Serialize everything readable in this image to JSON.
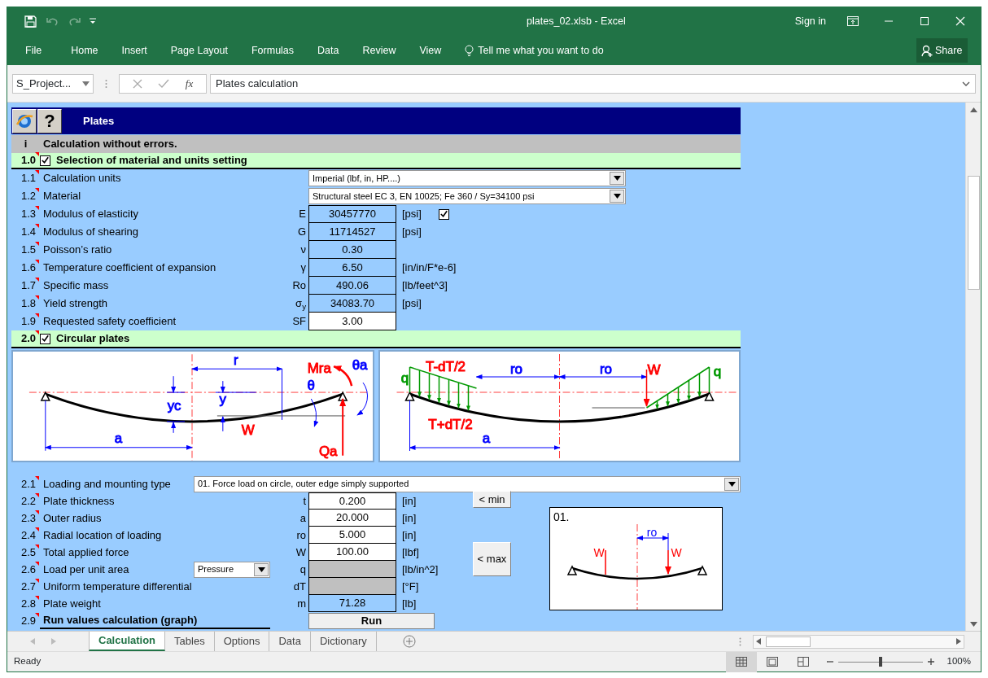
{
  "window": {
    "title": "plates_02.xlsb - Excel",
    "sign_in": "Sign in"
  },
  "quick_access": [
    {
      "kind": "save",
      "disabled": false
    },
    {
      "kind": "undo",
      "disabled": true
    },
    {
      "kind": "redo",
      "disabled": true
    }
  ],
  "ribbon": {
    "tabs": [
      "File",
      "Home",
      "Insert",
      "Page Layout",
      "Formulas",
      "Data",
      "Review",
      "View"
    ],
    "tell_me": "Tell me what you want to do",
    "share": "Share"
  },
  "formula_bar": {
    "name_box": "S_Project...",
    "function_label": "fx",
    "formula": "Plates calculation"
  },
  "sheet": {
    "header": {
      "help": "?",
      "title": "Plates"
    },
    "status_row": {
      "marker": "i",
      "text": "Calculation without errors."
    },
    "sections": [
      {
        "number": "1.0",
        "title": "Selection of material and units setting",
        "checked": true,
        "rows": [
          {
            "kind": "select",
            "number": "1.1",
            "label": "Calculation units",
            "value": "Imperial (lbf, in, HP....)"
          },
          {
            "kind": "select",
            "number": "1.2",
            "label": "Material",
            "value": "Structural steel EC 3, EN 10025; Fe 360 / Sy=34100 psi"
          },
          {
            "kind": "value",
            "number": "1.3",
            "label": "Modulus of elasticity",
            "symbol": "E",
            "value": "30457770",
            "unit": "[psi]",
            "editable": false,
            "disabled": false,
            "checked": true
          },
          {
            "kind": "value",
            "number": "1.4",
            "label": "Modulus of shearing",
            "symbol": "G",
            "value": "11714527",
            "unit": "[psi]",
            "editable": false,
            "disabled": false
          },
          {
            "kind": "value",
            "number": "1.5",
            "label": "Poisson’s ratio",
            "symbol": "ν",
            "value": "0.30",
            "editable": false,
            "disabled": false
          },
          {
            "kind": "value",
            "number": "1.6",
            "label": "Temperature coefficient of expansion",
            "symbol": "γ",
            "value": "6.50",
            "unit": "[in/in/F*e-6]",
            "editable": false,
            "disabled": false
          },
          {
            "kind": "value",
            "number": "1.7",
            "label": "Specific mass",
            "symbol": "Ro",
            "value": "490.06",
            "unit": "[lb/feet^3]",
            "editable": false,
            "disabled": false
          },
          {
            "kind": "value",
            "number": "1.8",
            "label": "Yield strength",
            "symbol": "σ$_{y}$",
            "value": "34083.70",
            "unit": "[psi]",
            "editable": false,
            "disabled": false
          },
          {
            "kind": "value",
            "number": "1.9",
            "label": "Requested safety coefficient",
            "symbol": "SF",
            "value": "3.00",
            "editable": true,
            "disabled": false
          }
        ]
      },
      {
        "number": "2.0",
        "title": "Circular plates",
        "checked": true,
        "diagrams": [
          {
            "labels": [
              {
                "text": "r",
                "color": "#0000ff"
              },
              {
                "text": "Mra",
                "color": "#ff0000"
              },
              {
                "text": "θa",
                "color": "#0000ff"
              },
              {
                "text": "θ",
                "color": "#0000ff"
              },
              {
                "text": "yc",
                "color": "#0000ff"
              },
              {
                "text": "y",
                "color": "#0000ff"
              },
              {
                "text": "W",
                "color": "#ff0000"
              },
              {
                "text": "Qa",
                "color": "#ff0000"
              },
              {
                "text": "a",
                "color": "#0000ff"
              }
            ]
          },
          {
            "labels": [
              {
                "text": "q",
                "color": "#009900"
              },
              {
                "text": "T-dT/2",
                "color": "#ff0000"
              },
              {
                "text": "ro",
                "color": "#0000ff"
              },
              {
                "text": "ro",
                "color": "#0000ff"
              },
              {
                "text": "W",
                "color": "#ff0000"
              },
              {
                "text": "q",
                "color": "#009900"
              },
              {
                "text": "T+dT/2",
                "color": "#ff0000"
              },
              {
                "text": "a",
                "color": "#0000ff"
              }
            ]
          }
        ],
        "rows": [
          {
            "kind": "select",
            "number": "2.1",
            "label": "Loading and mounting type",
            "value": "01. Force load on circle, outer edge simply supported"
          },
          {
            "kind": "value",
            "number": "2.2",
            "label": "Plate thickness",
            "symbol": "t",
            "value": "0.200",
            "unit": "[in]",
            "editable": true,
            "disabled": false
          },
          {
            "kind": "value",
            "number": "2.3",
            "label": "Outer radius",
            "symbol": "a",
            "value": "20.000",
            "unit": "[in]",
            "editable": true,
            "disabled": false
          },
          {
            "kind": "value",
            "number": "2.4",
            "label": "Radial location of loading",
            "symbol": "ro",
            "value": "5.000",
            "unit": "[in]",
            "editable": true,
            "disabled": false
          },
          {
            "kind": "value",
            "number": "2.5",
            "label": "Total applied force",
            "symbol": "W",
            "value": "100.00",
            "unit": "[lbf]",
            "editable": true,
            "disabled": false
          },
          {
            "kind": "value",
            "number": "2.6",
            "label": "Load per unit area",
            "option": "Pressure",
            "symbol": "q",
            "unit": "[lb/in^2]",
            "editable": false,
            "disabled": true
          },
          {
            "kind": "value",
            "number": "2.7",
            "label": "Uniform temperature differential",
            "symbol": "dT",
            "unit": "[°F]",
            "editable": false,
            "disabled": true
          },
          {
            "kind": "value",
            "number": "2.8",
            "label": "Plate weight",
            "symbol": "m",
            "value": "71.28",
            "unit": "[lb]",
            "editable": false,
            "disabled": false
          },
          {
            "kind": "action",
            "number": "2.9",
            "label": "Run values calculation (graph)",
            "button": "Run"
          }
        ],
        "buttons": [
          "< min",
          "< max"
        ],
        "preview": {
          "caption": "01.",
          "labels": [
            {
              "text": "W",
              "color": "#ff0000"
            },
            {
              "text": "ro",
              "color": "#0000ff"
            },
            {
              "text": "W",
              "color": "#ff0000"
            }
          ]
        }
      }
    ]
  },
  "sheet_tabs": [
    {
      "label": "Calculation",
      "selected": true
    },
    {
      "label": "Tables",
      "selected": false
    },
    {
      "label": "Options",
      "selected": false
    },
    {
      "label": "Data",
      "selected": false
    },
    {
      "label": "Dictionary",
      "selected": false
    }
  ],
  "status_bar": {
    "text": "Ready",
    "views": [
      {
        "kind": "normal",
        "selected": true
      },
      {
        "kind": "page-layout",
        "selected": false
      },
      {
        "kind": "page-break",
        "selected": false
      }
    ],
    "zoom": "100%",
    "level": 0.5
  }
}
